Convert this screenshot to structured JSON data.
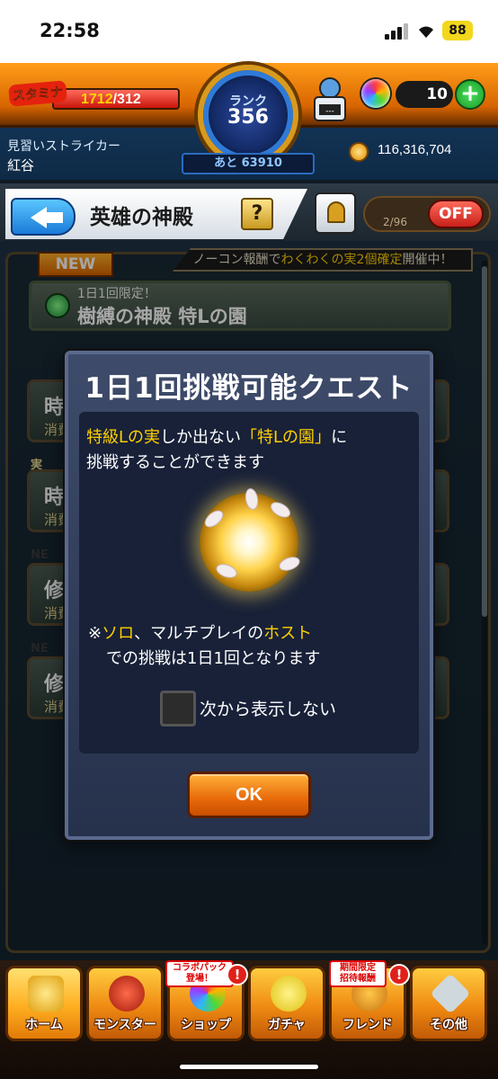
{
  "status_bar": {
    "time": "22:58",
    "battery": "88"
  },
  "header": {
    "stamina_label": "スタミナ",
    "stamina_current": "1712",
    "stamina_max": "/312",
    "stamina_fill": 1.0,
    "rank_label": "ランク",
    "rank_value": "356",
    "rank_next": "あと 63910",
    "orb_count": "10",
    "orb_plus": "+",
    "player_title": "見習いストライカー",
    "player_name": "紅谷",
    "gold": "116,316,704"
  },
  "title_bar": {
    "page_title": "英雄の神殿",
    "help": "?",
    "auto_counter": "2/96",
    "toggle": "OFF"
  },
  "list": {
    "banner": {
      "pre": "ノーコン報酬で",
      "highlight": "わくわくの実2個確定",
      "post": "開催中！"
    },
    "new_tag": "NEW",
    "quest_limit": "1日1回限定！",
    "quest_name": "樹縛の神殿 特Lの園",
    "items": [
      {
        "big": "時",
        "small": "消費"
      },
      {
        "tag": "実",
        "big": "時",
        "small": "消費"
      },
      {
        "tag": "NE",
        "big": "修",
        "small": "消費"
      },
      {
        "tag": "NE",
        "big": "修",
        "small": "消費"
      }
    ]
  },
  "modal": {
    "title": "1日1回挑戦可能クエスト",
    "msg_part1_highlight": "特級Lの実",
    "msg_part2": "しか出ない",
    "msg_part3_highlight": "「特Lの園」",
    "msg_part4": "に",
    "msg_line2": "挑戦することができます",
    "note_prefix": "※",
    "note_solo": "ソロ",
    "note_mid": "、マルチプレイの",
    "note_host": "ホスト",
    "note_line2": "での挑戦は1日1回となります",
    "checkbox_label": "次から表示しない",
    "ok_label": "OK"
  },
  "bottom_nav": {
    "items": [
      {
        "label": "ホーム"
      },
      {
        "label": "モンスター"
      },
      {
        "label": "ショップ"
      },
      {
        "label": "ガチャ"
      },
      {
        "label": "フレンド"
      },
      {
        "label": "その他"
      }
    ],
    "shop_badge": "コラボパック\n登場！",
    "friend_badge": "期間限定\n招待報酬",
    "alert": "!"
  }
}
